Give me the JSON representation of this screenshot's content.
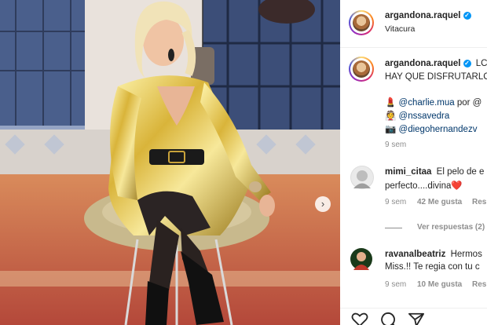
{
  "post": {
    "username": "argandona.raquel",
    "location": "Vitacura",
    "verified_glyph": "✓",
    "more_glyph": "···",
    "caption_text": "LC",
    "caption_line2": "HAY QUE DISFRUTARLC",
    "caption_age": "9 sem",
    "credits": [
      {
        "icon": "💄",
        "text": "@charlie.mua",
        "suffix": " por @"
      },
      {
        "icon": "👰",
        "text": "@nssavedra",
        "suffix": ""
      },
      {
        "icon": "📷",
        "text": "@diegohernandezv",
        "suffix": ""
      }
    ]
  },
  "comments": [
    {
      "username": "mimi_citaa",
      "text_line1": "El pelo de e",
      "text_line2": "perfecto....divina",
      "emoji": "❤️",
      "age": "9 sem",
      "likes": "42 Me gusta",
      "reply": "Res",
      "view_replies": "Ver respuestas (2)",
      "avatar_color": "#e8e8e8"
    },
    {
      "username": "ravanalbeatriz",
      "text_line1": "Hermos",
      "text_line2": "Miss.!! Te regia con tu c",
      "age": "9 sem",
      "likes": "10 Me gusta",
      "reply": "Res",
      "avatar_color": "#c0392b"
    }
  ],
  "carousel": {
    "next_glyph": "›"
  },
  "icons": [
    "heart-icon",
    "comment-icon",
    "share-icon"
  ]
}
